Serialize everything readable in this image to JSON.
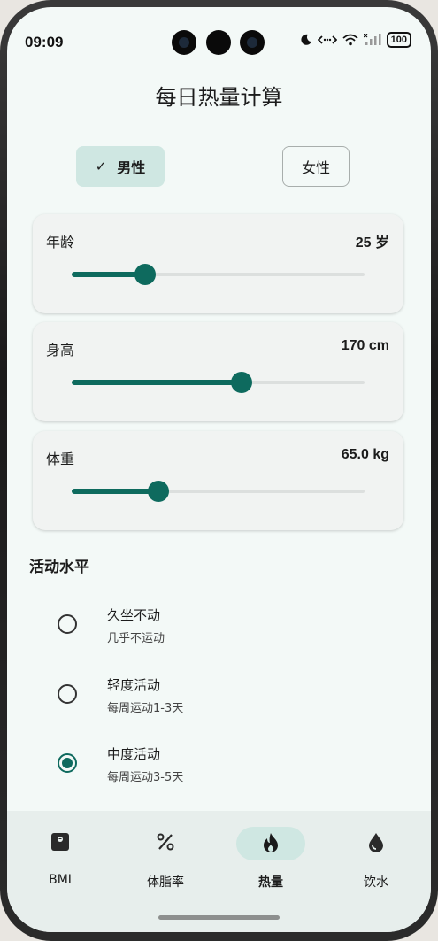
{
  "status_bar": {
    "time": "09:09",
    "battery": "100"
  },
  "page_title": "每日热量计算",
  "gender": {
    "male": "男性",
    "female": "女性",
    "selected": "male"
  },
  "sliders": {
    "age": {
      "label": "年龄",
      "value_text": "25 岁",
      "fraction": 0.25
    },
    "height": {
      "label": "身高",
      "value_text": "170 cm",
      "fraction": 0.58
    },
    "weight": {
      "label": "体重",
      "value_text": "65.0 kg",
      "fraction": 0.295
    }
  },
  "activity": {
    "title": "活动水平",
    "options": [
      {
        "title": "久坐不动",
        "subtitle": "几乎不运动",
        "selected": false
      },
      {
        "title": "轻度活动",
        "subtitle": "每周运动1-3天",
        "selected": false
      },
      {
        "title": "中度活动",
        "subtitle": "每周运动3-5天",
        "selected": true
      }
    ]
  },
  "nav": {
    "items": [
      {
        "label": "BMI",
        "icon": "bmi-icon",
        "active": false
      },
      {
        "label": "体脂率",
        "icon": "percent-icon",
        "active": false
      },
      {
        "label": "热量",
        "icon": "flame-icon",
        "active": true
      },
      {
        "label": "饮水",
        "icon": "water-drop-icon",
        "active": false
      }
    ]
  },
  "colors": {
    "accent": "#0e6a5e",
    "accent_container": "#cfe7e2",
    "background": "#f3f9f7"
  }
}
